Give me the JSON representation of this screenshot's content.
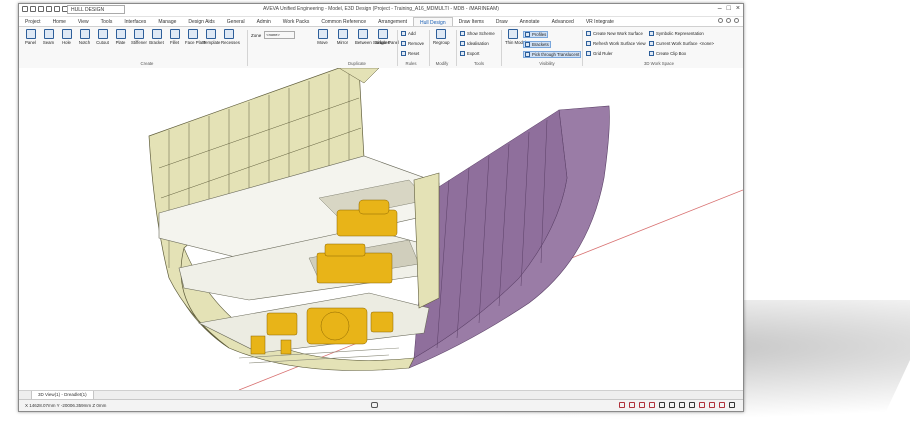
{
  "app": {
    "window_title": "AVEVA Unified Engineering - Model, E3D Design (Project - Training_A16_MDMULTI - MDB - /MARINEAM)",
    "qat_selector": "HULL DESIGN"
  },
  "tabs": [
    "Project",
    "Home",
    "View",
    "Tools",
    "Interfaces",
    "Manage",
    "Design Aids",
    "General",
    "Admin",
    "Work Packs",
    "Common Reference",
    "Arrangement",
    "Hull Design",
    "Draw Items",
    "Draw",
    "Annotate",
    "Advanced",
    "VR Integrate"
  ],
  "active_tab": "Hull Design",
  "ribbon": {
    "create_buttons": [
      "Panel",
      "Seam",
      "Hole",
      "Notch",
      "Cutout",
      "Plate",
      "Stiffener",
      "Bracket",
      "Fillet",
      "Face Plate",
      "Template",
      "Recesses"
    ],
    "zone_label": "Zone",
    "zone_value": "<none>",
    "duplicate_buttons": [
      "Move",
      "Mirror",
      "Between Surfaces",
      "Single Panel"
    ],
    "rules_items": [
      "Add",
      "Remove",
      "Reset"
    ],
    "modify_buttons": [
      "Regroup"
    ],
    "tools_items": [
      "Show Scheme",
      "Idealisation",
      "Export"
    ],
    "visibility_buttons": [
      "Thin Models"
    ],
    "visibility_items": [
      "Profiles",
      "Brackets",
      "Pick through Translucent"
    ],
    "workspace_items": [
      "Create New Work Surface",
      "Refresh Work Surface View",
      "Grid Ruler"
    ],
    "workspace_items2": [
      "Symbolic Representation",
      "Current Work Surface",
      "Create Clip Box"
    ],
    "current_ws_value": "<none>",
    "groups": [
      "Create",
      "Duplicate",
      "Rules",
      "Modify",
      "Tools",
      "Visibility",
      "3D Work Space"
    ]
  },
  "view_tab": "3D View(1) - Dreadlet(1)",
  "status": {
    "coords": "X 14628.07mm Y -20006.359mm Z 0mm"
  },
  "colors": {
    "hull_outer": "#9a7ca6",
    "hull_outer_dark": "#6e4f7c",
    "structure": "#e4e2b6",
    "structure_edge": "#5f5d3c",
    "deck": "#f4f4ee",
    "machinery": "#e8b418",
    "accent_axis": "#d87070"
  }
}
